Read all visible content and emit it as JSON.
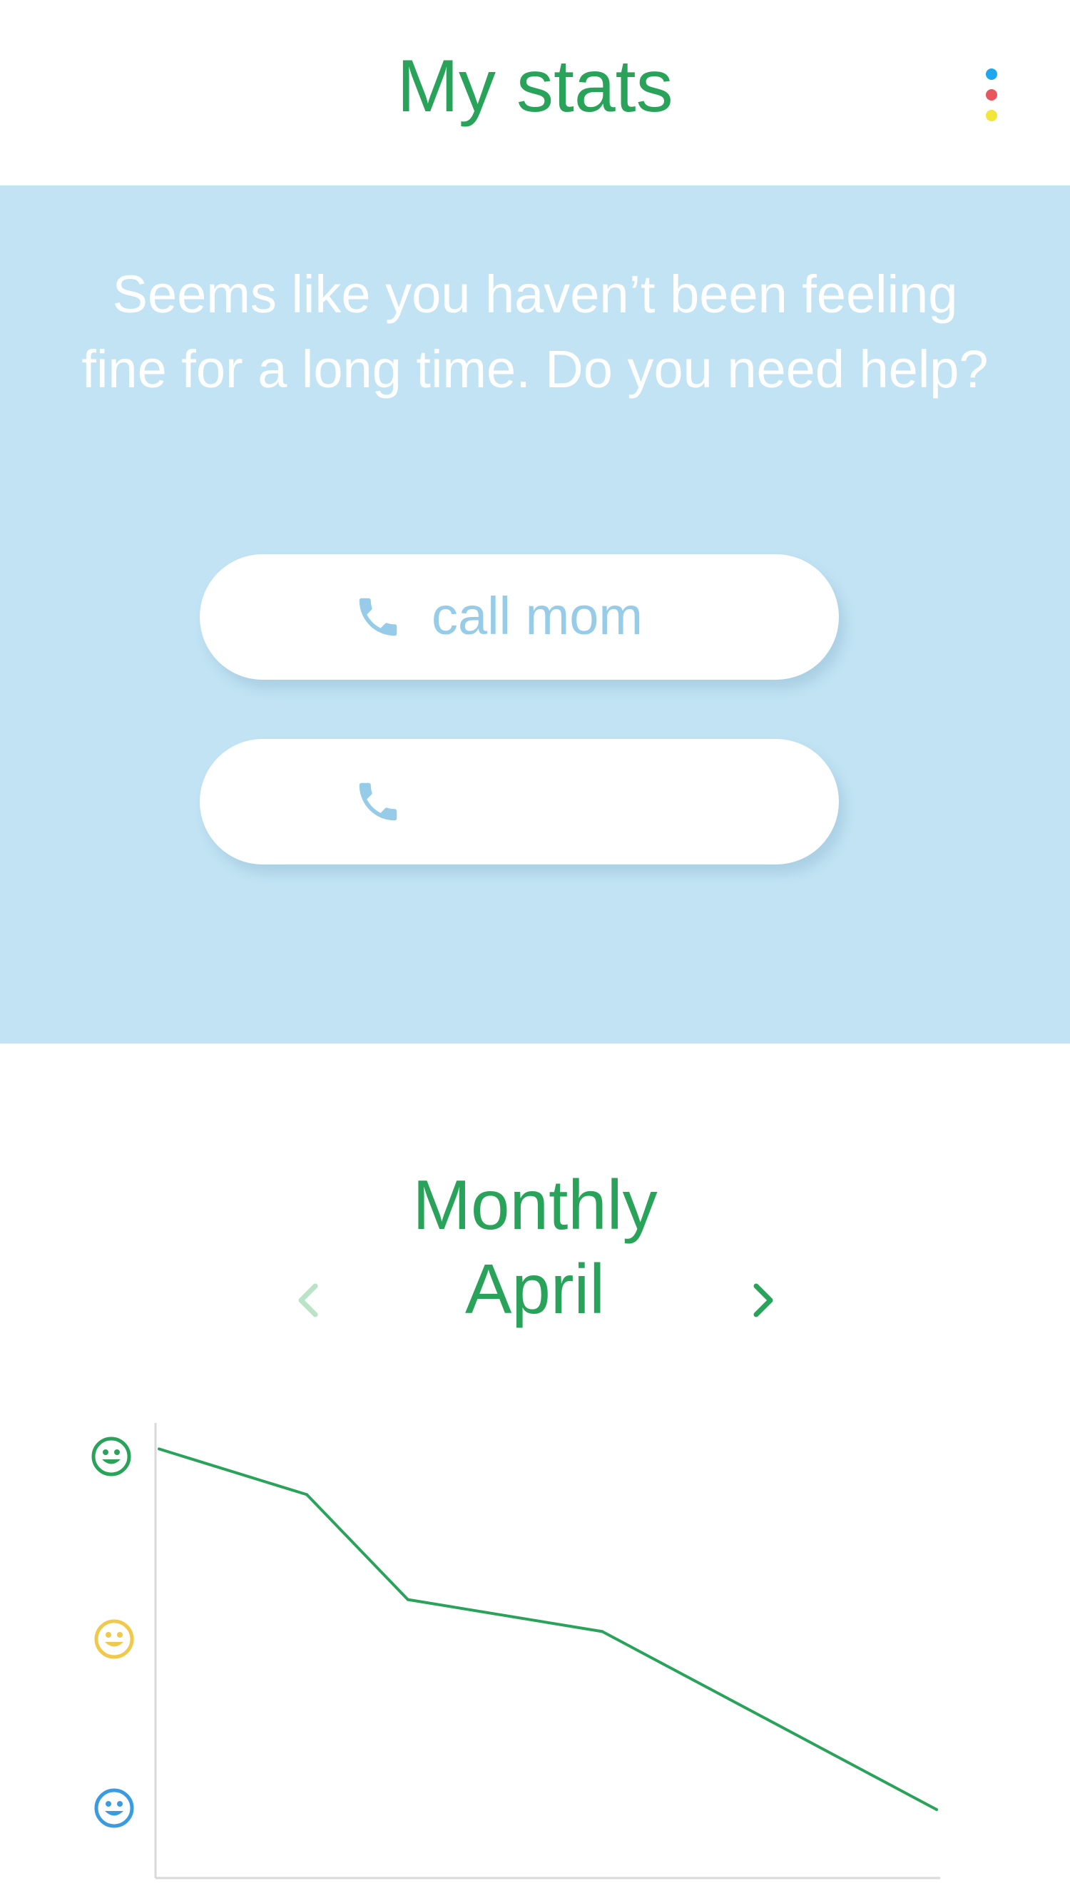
{
  "header": {
    "title": "My stats",
    "menu_icon": "more-vert-icon",
    "menu_dot_colors": [
      "#1ea7ee",
      "#e9565e",
      "#f3e53a"
    ]
  },
  "banner": {
    "message": "Seems like you haven’t been feeling fine for a long time. Do you need help?",
    "buttons": [
      {
        "label": "call mom",
        "icon": "phone-icon"
      },
      {
        "label": "",
        "icon": "phone-icon"
      }
    ]
  },
  "stats": {
    "period": "Monthly",
    "month": "April",
    "prev_icon": "chevron-left-icon",
    "next_icon": "chevron-right-icon"
  },
  "colors": {
    "accent": "#2aa35a",
    "banner_bg": "#c1e3f4",
    "phone": "#97cce9",
    "mood_happy": "#2aa35a",
    "mood_neutral": "#f1c94a",
    "mood_sad": "#3a9be0"
  },
  "chart_data": {
    "type": "line",
    "y_levels": [
      "happy",
      "neutral",
      "sad"
    ],
    "y_icons": [
      "smiley-happy-icon",
      "smiley-neutral-icon",
      "smiley-sad-icon"
    ],
    "x": [
      0,
      0.19,
      0.32,
      0.57,
      1.0
    ],
    "values": [
      0.94,
      0.84,
      0.61,
      0.54,
      0.15
    ],
    "xlim": [
      0,
      1
    ],
    "ylim": [
      0,
      1
    ],
    "grid": false
  }
}
